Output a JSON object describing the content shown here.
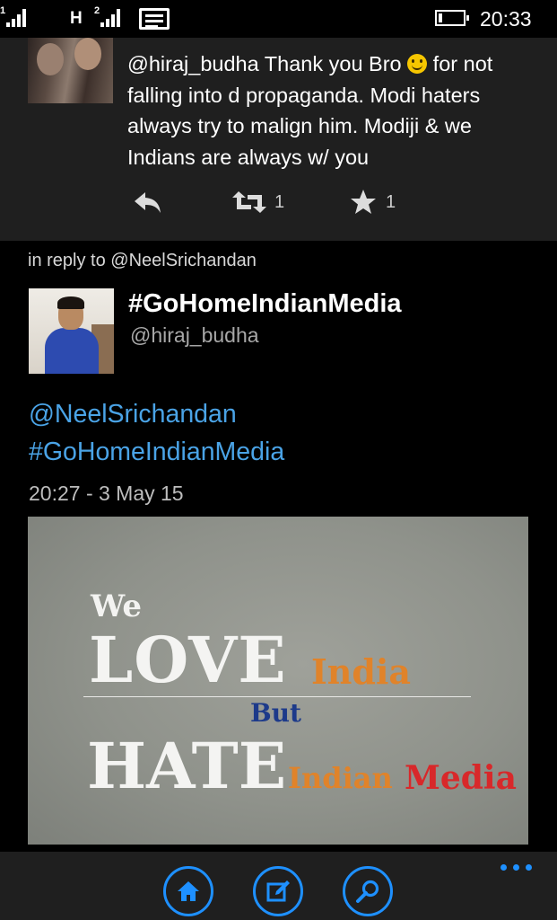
{
  "status_bar": {
    "sim1_label": "1",
    "sim2_label": "2",
    "network_type": "H",
    "time": "20:33",
    "icons": [
      "signal-icon",
      "signal-icon",
      "message-icon",
      "battery-icon"
    ]
  },
  "previous_tweet": {
    "text_before_emoji": "@hiraj_budha Thank you Bro ",
    "emoji": "smiling-face",
    "text_after_emoji": " for not falling into d propaganda. Modi haters always try to malign him. Modiji & we Indians are always w/ you",
    "retweet_count": "1",
    "favorite_count": "1"
  },
  "reply_context": "in reply to @NeelSrichandan",
  "tweet": {
    "display_name": "#GoHomeIndianMedia",
    "handle": "@hiraj_budha",
    "mention": "@NeelSrichandan",
    "hashtag": "#GoHomeIndianMedia",
    "timestamp": "20:27 - 3 May 15"
  },
  "media_image": {
    "line1": "We",
    "line2": "LOVE",
    "line2_suffix": "India",
    "line3": "But",
    "line4": "HATE",
    "line4_suffix_a": "Indian",
    "line4_suffix_b": "Media"
  },
  "app_bar": {
    "buttons": [
      "home-icon",
      "compose-icon",
      "search-icon"
    ],
    "accent_color": "#1e90ff"
  },
  "colors": {
    "link": "#4aa3e6",
    "card_background": "#1f1f1f",
    "background": "#000000"
  }
}
